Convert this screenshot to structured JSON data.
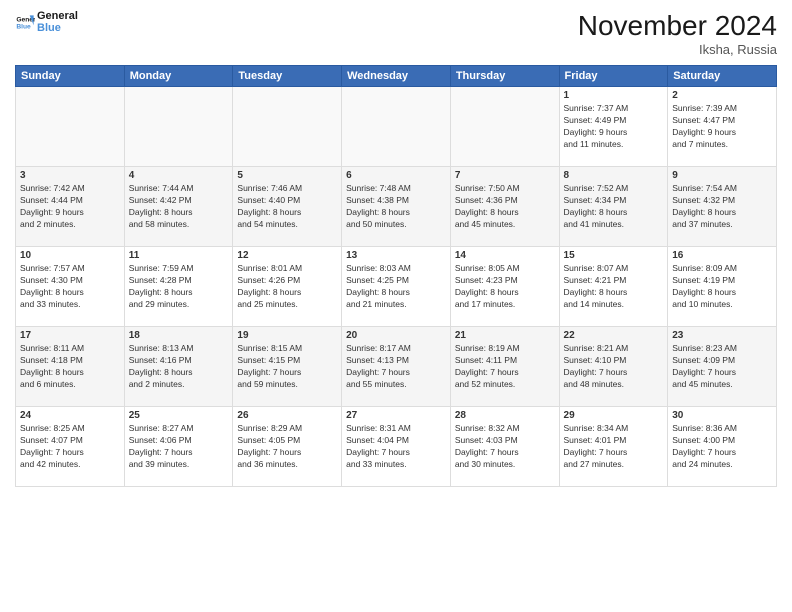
{
  "header": {
    "logo_general": "General",
    "logo_blue": "Blue",
    "month_title": "November 2024",
    "location": "Iksha, Russia"
  },
  "weekdays": [
    "Sunday",
    "Monday",
    "Tuesday",
    "Wednesday",
    "Thursday",
    "Friday",
    "Saturday"
  ],
  "weeks": [
    [
      {
        "day": "",
        "info": ""
      },
      {
        "day": "",
        "info": ""
      },
      {
        "day": "",
        "info": ""
      },
      {
        "day": "",
        "info": ""
      },
      {
        "day": "",
        "info": ""
      },
      {
        "day": "1",
        "info": "Sunrise: 7:37 AM\nSunset: 4:49 PM\nDaylight: 9 hours\nand 11 minutes."
      },
      {
        "day": "2",
        "info": "Sunrise: 7:39 AM\nSunset: 4:47 PM\nDaylight: 9 hours\nand 7 minutes."
      }
    ],
    [
      {
        "day": "3",
        "info": "Sunrise: 7:42 AM\nSunset: 4:44 PM\nDaylight: 9 hours\nand 2 minutes."
      },
      {
        "day": "4",
        "info": "Sunrise: 7:44 AM\nSunset: 4:42 PM\nDaylight: 8 hours\nand 58 minutes."
      },
      {
        "day": "5",
        "info": "Sunrise: 7:46 AM\nSunset: 4:40 PM\nDaylight: 8 hours\nand 54 minutes."
      },
      {
        "day": "6",
        "info": "Sunrise: 7:48 AM\nSunset: 4:38 PM\nDaylight: 8 hours\nand 50 minutes."
      },
      {
        "day": "7",
        "info": "Sunrise: 7:50 AM\nSunset: 4:36 PM\nDaylight: 8 hours\nand 45 minutes."
      },
      {
        "day": "8",
        "info": "Sunrise: 7:52 AM\nSunset: 4:34 PM\nDaylight: 8 hours\nand 41 minutes."
      },
      {
        "day": "9",
        "info": "Sunrise: 7:54 AM\nSunset: 4:32 PM\nDaylight: 8 hours\nand 37 minutes."
      }
    ],
    [
      {
        "day": "10",
        "info": "Sunrise: 7:57 AM\nSunset: 4:30 PM\nDaylight: 8 hours\nand 33 minutes."
      },
      {
        "day": "11",
        "info": "Sunrise: 7:59 AM\nSunset: 4:28 PM\nDaylight: 8 hours\nand 29 minutes."
      },
      {
        "day": "12",
        "info": "Sunrise: 8:01 AM\nSunset: 4:26 PM\nDaylight: 8 hours\nand 25 minutes."
      },
      {
        "day": "13",
        "info": "Sunrise: 8:03 AM\nSunset: 4:25 PM\nDaylight: 8 hours\nand 21 minutes."
      },
      {
        "day": "14",
        "info": "Sunrise: 8:05 AM\nSunset: 4:23 PM\nDaylight: 8 hours\nand 17 minutes."
      },
      {
        "day": "15",
        "info": "Sunrise: 8:07 AM\nSunset: 4:21 PM\nDaylight: 8 hours\nand 14 minutes."
      },
      {
        "day": "16",
        "info": "Sunrise: 8:09 AM\nSunset: 4:19 PM\nDaylight: 8 hours\nand 10 minutes."
      }
    ],
    [
      {
        "day": "17",
        "info": "Sunrise: 8:11 AM\nSunset: 4:18 PM\nDaylight: 8 hours\nand 6 minutes."
      },
      {
        "day": "18",
        "info": "Sunrise: 8:13 AM\nSunset: 4:16 PM\nDaylight: 8 hours\nand 2 minutes."
      },
      {
        "day": "19",
        "info": "Sunrise: 8:15 AM\nSunset: 4:15 PM\nDaylight: 7 hours\nand 59 minutes."
      },
      {
        "day": "20",
        "info": "Sunrise: 8:17 AM\nSunset: 4:13 PM\nDaylight: 7 hours\nand 55 minutes."
      },
      {
        "day": "21",
        "info": "Sunrise: 8:19 AM\nSunset: 4:11 PM\nDaylight: 7 hours\nand 52 minutes."
      },
      {
        "day": "22",
        "info": "Sunrise: 8:21 AM\nSunset: 4:10 PM\nDaylight: 7 hours\nand 48 minutes."
      },
      {
        "day": "23",
        "info": "Sunrise: 8:23 AM\nSunset: 4:09 PM\nDaylight: 7 hours\nand 45 minutes."
      }
    ],
    [
      {
        "day": "24",
        "info": "Sunrise: 8:25 AM\nSunset: 4:07 PM\nDaylight: 7 hours\nand 42 minutes."
      },
      {
        "day": "25",
        "info": "Sunrise: 8:27 AM\nSunset: 4:06 PM\nDaylight: 7 hours\nand 39 minutes."
      },
      {
        "day": "26",
        "info": "Sunrise: 8:29 AM\nSunset: 4:05 PM\nDaylight: 7 hours\nand 36 minutes."
      },
      {
        "day": "27",
        "info": "Sunrise: 8:31 AM\nSunset: 4:04 PM\nDaylight: 7 hours\nand 33 minutes."
      },
      {
        "day": "28",
        "info": "Sunrise: 8:32 AM\nSunset: 4:03 PM\nDaylight: 7 hours\nand 30 minutes."
      },
      {
        "day": "29",
        "info": "Sunrise: 8:34 AM\nSunset: 4:01 PM\nDaylight: 7 hours\nand 27 minutes."
      },
      {
        "day": "30",
        "info": "Sunrise: 8:36 AM\nSunset: 4:00 PM\nDaylight: 7 hours\nand 24 minutes."
      }
    ]
  ]
}
